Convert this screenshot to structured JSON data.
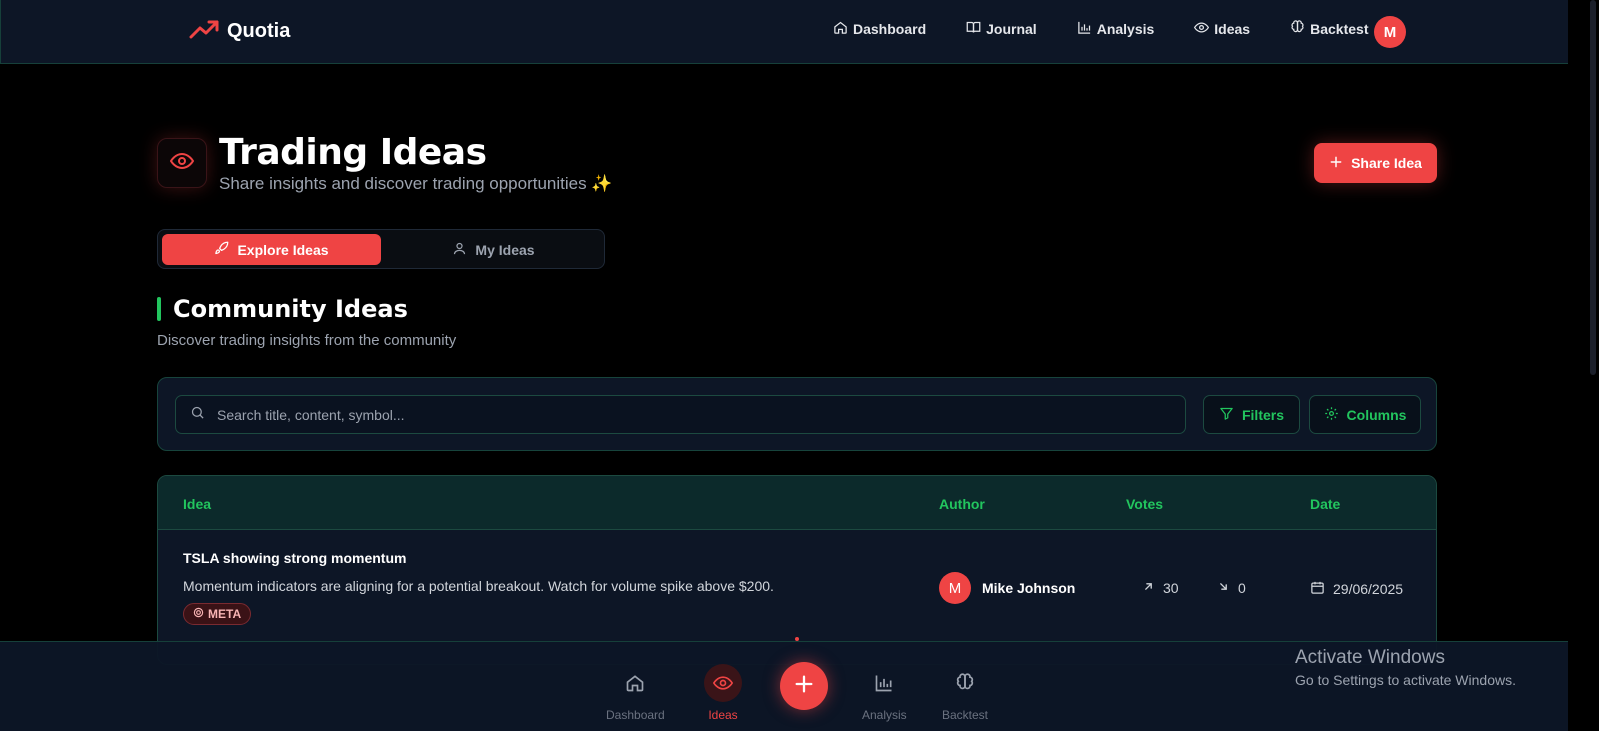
{
  "brand": {
    "name": "Quotia",
    "accent": "#ef4444"
  },
  "nav": [
    {
      "label": "Dashboard",
      "icon": "home-icon"
    },
    {
      "label": "Journal",
      "icon": "book-icon"
    },
    {
      "label": "Analysis",
      "icon": "bar-chart-icon"
    },
    {
      "label": "Ideas",
      "icon": "eye-icon"
    },
    {
      "label": "Backtest",
      "icon": "brain-icon"
    }
  ],
  "user": {
    "initial": "M"
  },
  "header": {
    "title": "Trading Ideas",
    "subtitle": "Share insights and discover trading opportunities ✨",
    "share_label": "Share Idea"
  },
  "tabs": [
    {
      "label": "Explore Ideas",
      "active": true,
      "icon": "rocket-icon"
    },
    {
      "label": "My Ideas",
      "active": false,
      "icon": "user-icon"
    }
  ],
  "section": {
    "title": "Community Ideas",
    "subtitle": "Discover trading insights from the community"
  },
  "search": {
    "placeholder": "Search title, content, symbol...",
    "value": ""
  },
  "filters_label": "Filters",
  "columns_label": "Columns",
  "table": {
    "headers": {
      "idea": "Idea",
      "author": "Author",
      "votes": "Votes",
      "date": "Date"
    },
    "rows": [
      {
        "title": "TSLA showing strong momentum",
        "description": "Momentum indicators are aligning for a potential breakout. Watch for volume spike above $200.",
        "tag": "META",
        "author_initial": "M",
        "author": "Mike Johnson",
        "upvotes": "30",
        "downvotes": "0",
        "date": "29/06/2025"
      }
    ]
  },
  "bottom_nav": [
    {
      "label": "Dashboard",
      "icon": "home-icon",
      "active": false
    },
    {
      "label": "Ideas",
      "icon": "eye-icon",
      "active": true
    },
    {
      "label": "Analysis",
      "icon": "bar-chart-icon",
      "active": false
    },
    {
      "label": "Backtest",
      "icon": "brain-icon",
      "active": false
    }
  ],
  "windows_watermark": {
    "title": "Activate Windows",
    "subtitle": "Go to Settings to activate Windows."
  }
}
